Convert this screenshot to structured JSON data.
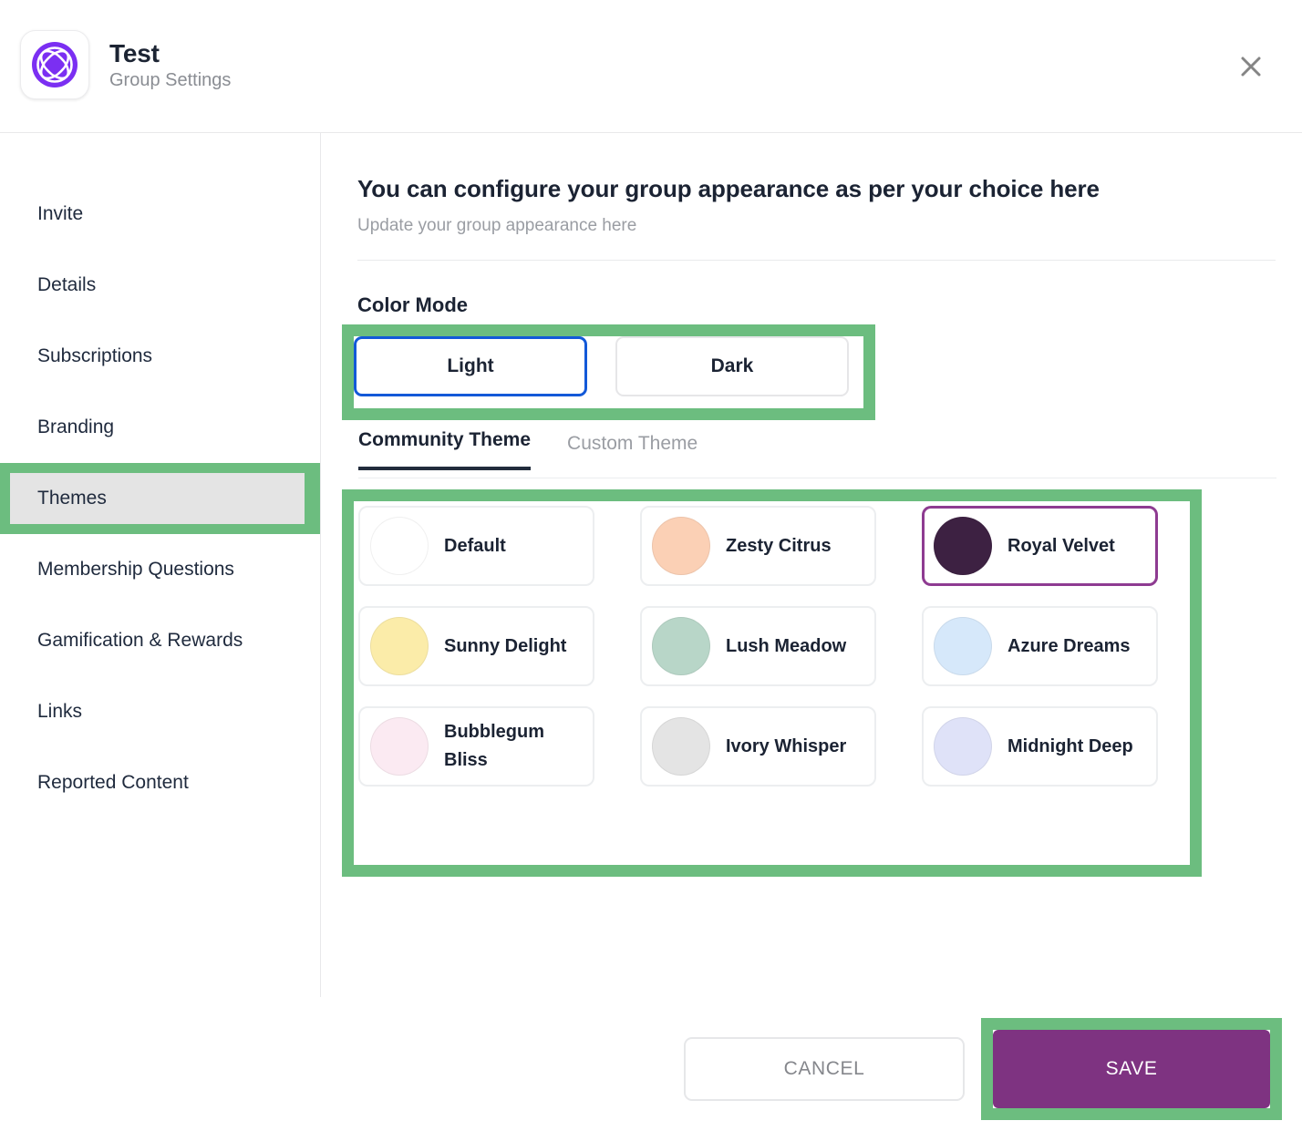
{
  "header": {
    "title": "Test",
    "subtitle": "Group Settings",
    "logo_icon": "group-logo-icon",
    "logo_color": "#7b2ff2",
    "close_icon": "close-icon"
  },
  "sidebar": {
    "items": [
      {
        "label": "Invite",
        "active": false
      },
      {
        "label": "Details",
        "active": false
      },
      {
        "label": "Subscriptions",
        "active": false
      },
      {
        "label": "Branding",
        "active": false
      },
      {
        "label": "Themes",
        "active": true
      },
      {
        "label": "Membership Questions",
        "active": false
      },
      {
        "label": "Gamification & Rewards",
        "active": false
      },
      {
        "label": "Links",
        "active": false
      },
      {
        "label": "Reported Content",
        "active": false
      }
    ]
  },
  "main": {
    "heading": "You can configure your group appearance as per your choice here",
    "subheading": "Update your group appearance here",
    "color_mode_label": "Color Mode",
    "color_modes": [
      {
        "label": "Light",
        "selected": true
      },
      {
        "label": "Dark",
        "selected": false
      }
    ],
    "tabs": [
      {
        "label": "Community Theme",
        "active": true
      },
      {
        "label": "Custom Theme",
        "active": false
      }
    ],
    "themes": [
      {
        "label": "Default",
        "swatch": "#ffffff",
        "selected": false
      },
      {
        "label": "Zesty Citrus",
        "swatch": "#fbd0b5",
        "selected": false
      },
      {
        "label": "Royal Velvet",
        "swatch": "#3d2142",
        "selected": true
      },
      {
        "label": "Sunny Delight",
        "swatch": "#fbeca9",
        "selected": false
      },
      {
        "label": "Lush Meadow",
        "swatch": "#b8d6c8",
        "selected": false
      },
      {
        "label": "Azure Dreams",
        "swatch": "#d6e8fa",
        "selected": false
      },
      {
        "label": "Bubblegum Bliss",
        "swatch": "#fbeaf2",
        "selected": false
      },
      {
        "label": "Ivory Whisper",
        "swatch": "#e4e4e4",
        "selected": false
      },
      {
        "label": "Midnight Deep",
        "swatch": "#dfe2f8",
        "selected": false
      }
    ]
  },
  "footer": {
    "cancel_label": "CANCEL",
    "save_label": "SAVE",
    "save_color": "#7e3381"
  },
  "highlight_color": "#6cbd7f"
}
